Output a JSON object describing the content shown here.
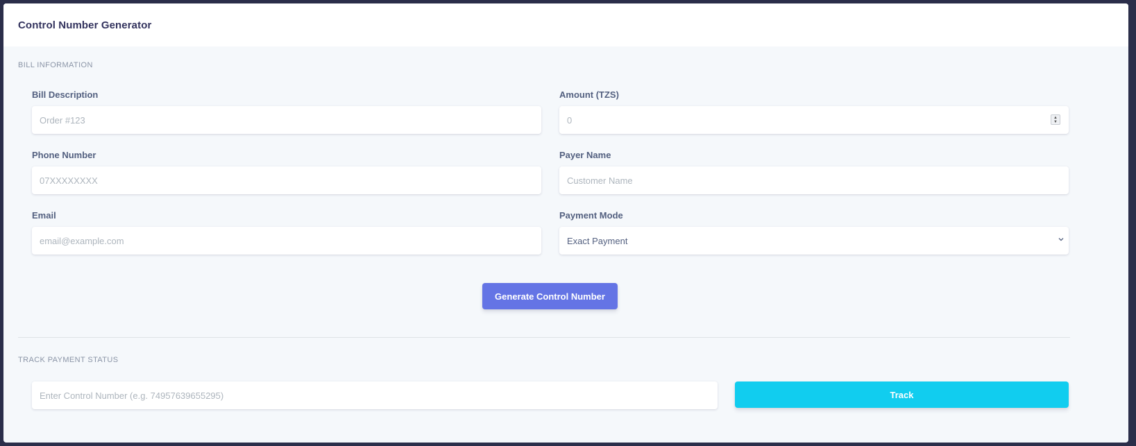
{
  "header": {
    "title": "Control Number Generator"
  },
  "bill_section": {
    "label": "BILL INFORMATION",
    "fields": {
      "bill_description": {
        "label": "Bill Description",
        "placeholder": "Order #123"
      },
      "amount": {
        "label": "Amount (TZS)",
        "placeholder": "0"
      },
      "phone": {
        "label": "Phone Number",
        "placeholder": "07XXXXXXXX"
      },
      "payer_name": {
        "label": "Payer Name",
        "placeholder": "Customer Name"
      },
      "email": {
        "label": "Email",
        "placeholder": "email@example.com"
      },
      "payment_mode": {
        "label": "Payment Mode",
        "selected": "Exact Payment"
      }
    },
    "generate_button": "Generate Control Number"
  },
  "track_section": {
    "label": "TRACK PAYMENT STATUS",
    "control_number_placeholder": "Enter Control Number (e.g. 74957639655295)",
    "track_button": "Track"
  },
  "colors": {
    "primary": "#6474e5",
    "info": "#11cdef",
    "background": "#f5f8fb"
  }
}
